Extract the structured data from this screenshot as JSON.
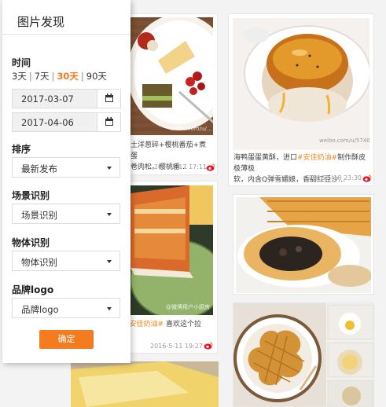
{
  "panel": {
    "title": "图片发现",
    "time_label": "时间",
    "ranges": [
      "3天",
      "7天",
      "30天",
      "90天"
    ],
    "active_range": "30天",
    "date_from": "2017-03-07",
    "date_to": "2017-04-06",
    "sort_label": "排序",
    "sort_value": "最新发布",
    "scene_label": "场景识别",
    "scene_value": "场景识别",
    "object_label": "物体识别",
    "object_value": "物体识别",
    "brand_label": "品牌logo",
    "brand_value": "品牌logo",
    "confirm": "确定"
  },
  "feed": {
    "card1": {
      "caption_a": "…土洋葱碎+樱桃番茄+煮鸡蛋",
      "caption_b": "…卷肉松。樱桃番…",
      "date": "2016-5-17  17:11",
      "watermark": "weibo.com/u/…"
    },
    "card2": {
      "caption_a": "海鸭蛋蛋黄酥，进口",
      "caption_tag": "#安佳奶油#",
      "caption_b": "制作酥皮极薄极",
      "caption_c": "软，内含Q弹雪媚娘，香甜红豆沙…",
      "date": "2016-5-18  23:30",
      "watermark": "weibo.com/u/5740…"
    },
    "card3": {
      "caption_tag": "#安佳奶油#",
      "caption_b": " 喜欢这个拉",
      "date": "2016-5-11  19:27",
      "watermark": "@微博用户小厨房"
    }
  }
}
